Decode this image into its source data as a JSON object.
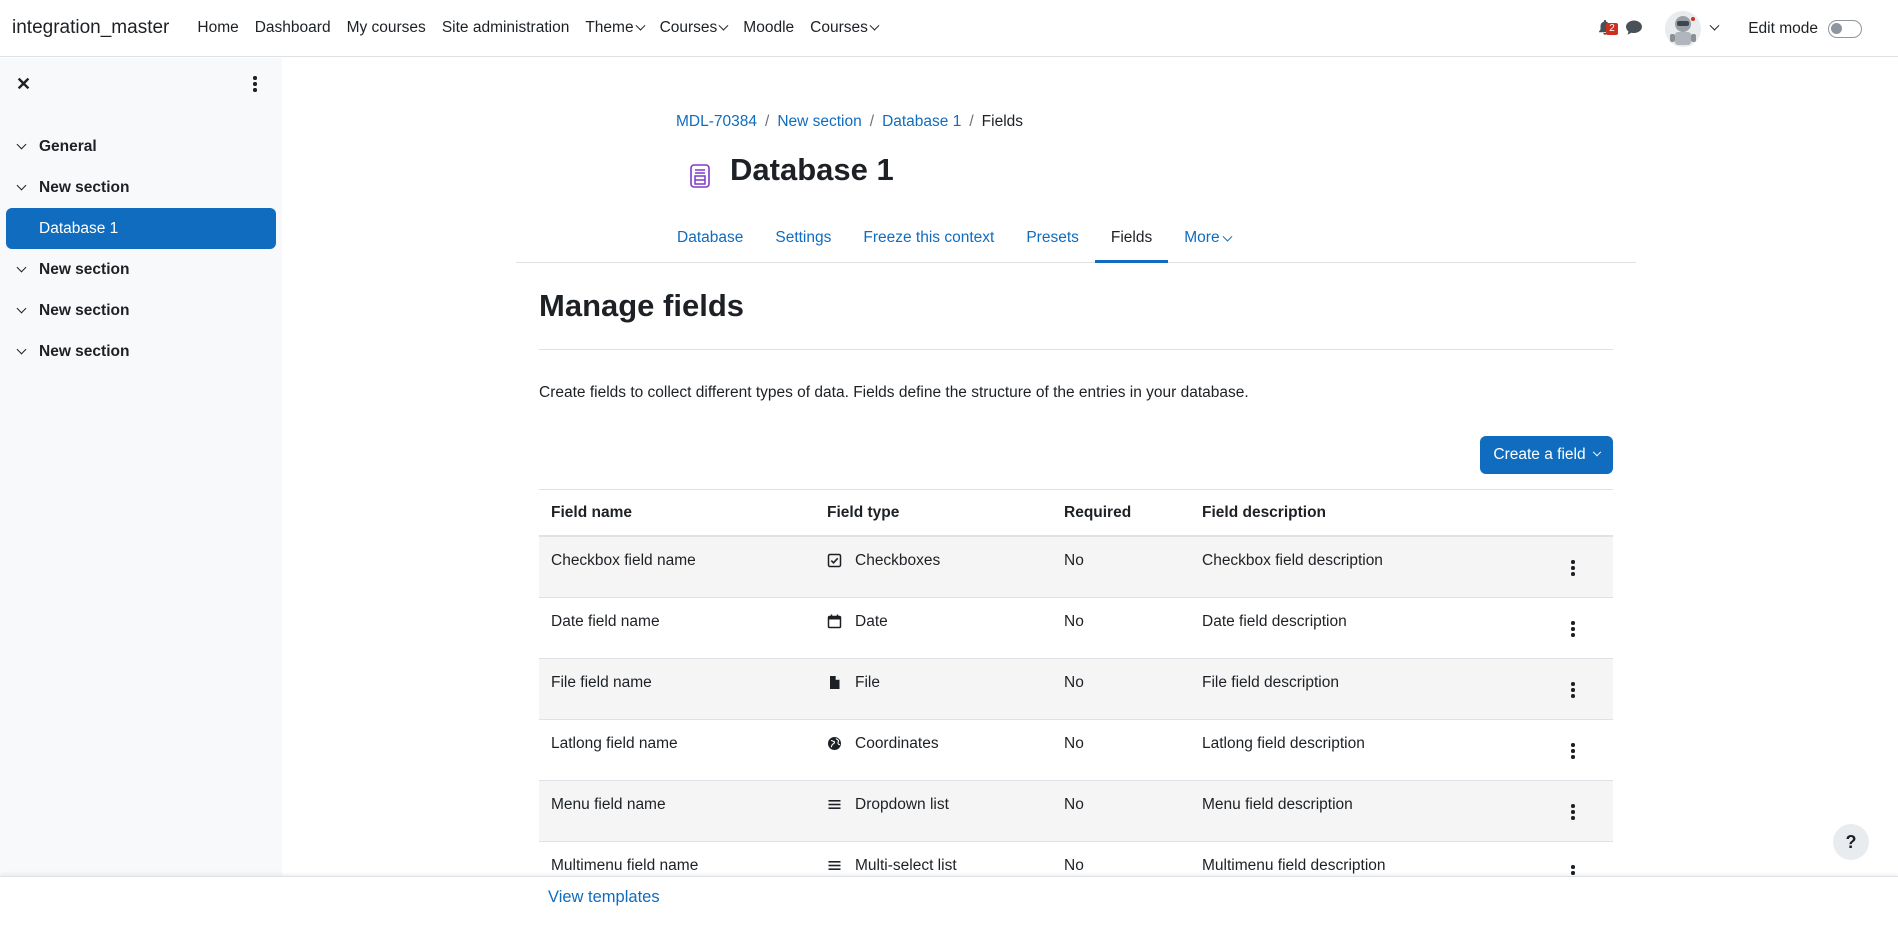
{
  "navbar": {
    "brand": "integration_master",
    "links": [
      {
        "label": "Home"
      },
      {
        "label": "Dashboard"
      },
      {
        "label": "My courses"
      },
      {
        "label": "Site administration"
      },
      {
        "label": "Theme"
      },
      {
        "label": "Courses"
      },
      {
        "label": "Moodle"
      },
      {
        "label": "Courses"
      }
    ],
    "notification_count": "2",
    "edit_mode_label": "Edit mode"
  },
  "drawer": {
    "items": [
      {
        "label": "General"
      },
      {
        "label": "New section"
      },
      {
        "label": "Database 1"
      },
      {
        "label": "New section"
      },
      {
        "label": "New section"
      },
      {
        "label": "New section"
      }
    ]
  },
  "breadcrumb": [
    "MDL-70384",
    "New section",
    "Database 1",
    "Fields"
  ],
  "page": {
    "title": "Database 1"
  },
  "tabs": [
    "Database",
    "Settings",
    "Freeze this context",
    "Presets",
    "Fields",
    "More"
  ],
  "main": {
    "heading": "Manage fields",
    "description": "Create fields to collect different types of data. Fields define the structure of the entries in your database.",
    "create_button": "Create a field"
  },
  "table": {
    "headers": [
      "Field name",
      "Field type",
      "Required",
      "Field description"
    ],
    "rows": [
      {
        "name": "Checkbox field name",
        "type": "Checkboxes",
        "icon": "checkbox-icon",
        "required": "No",
        "description": "Checkbox field description"
      },
      {
        "name": "Date field name",
        "type": "Date",
        "icon": "calendar-icon",
        "required": "No",
        "description": "Date field description"
      },
      {
        "name": "File field name",
        "type": "File",
        "icon": "file-icon",
        "required": "No",
        "description": "File field description"
      },
      {
        "name": "Latlong field name",
        "type": "Coordinates",
        "icon": "globe-icon",
        "required": "No",
        "description": "Latlong field description"
      },
      {
        "name": "Menu field name",
        "type": "Dropdown list",
        "icon": "list-icon",
        "required": "No",
        "description": "Menu field description"
      },
      {
        "name": "Multimenu field name",
        "type": "Multi-select list",
        "icon": "list-icon",
        "required": "No",
        "description": "Multimenu field description"
      }
    ]
  },
  "footer": {
    "link": "View templates"
  },
  "help_label": "?",
  "colors": {
    "primary": "#0f6cbf",
    "drawer_bg": "#f8f9fa",
    "badge": "#ca3120",
    "activity_icon": "#7e3bc9"
  }
}
